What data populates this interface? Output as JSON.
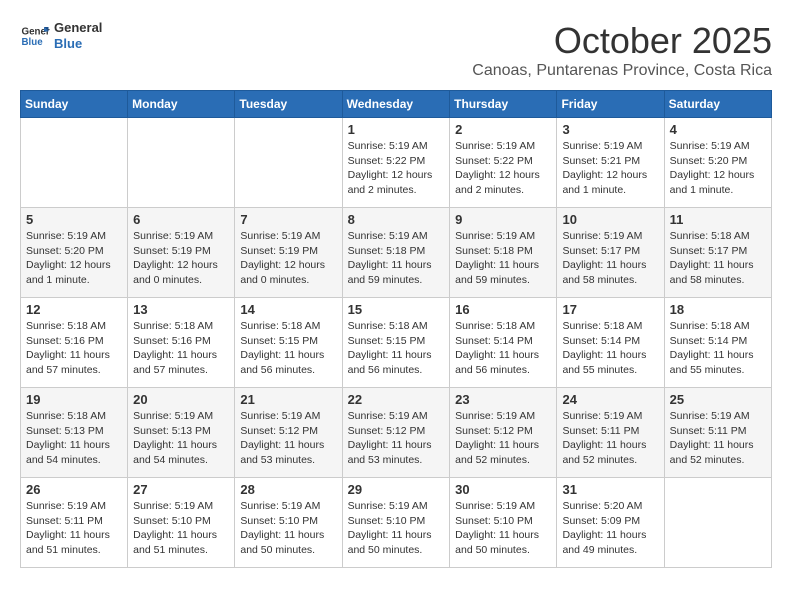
{
  "logo": {
    "line1": "General",
    "line2": "Blue"
  },
  "title": "October 2025",
  "location": "Canoas, Puntarenas Province, Costa Rica",
  "days_of_week": [
    "Sunday",
    "Monday",
    "Tuesday",
    "Wednesday",
    "Thursday",
    "Friday",
    "Saturday"
  ],
  "weeks": [
    [
      {
        "day": "",
        "info": ""
      },
      {
        "day": "",
        "info": ""
      },
      {
        "day": "",
        "info": ""
      },
      {
        "day": "1",
        "info": "Sunrise: 5:19 AM\nSunset: 5:22 PM\nDaylight: 12 hours and 2 minutes."
      },
      {
        "day": "2",
        "info": "Sunrise: 5:19 AM\nSunset: 5:22 PM\nDaylight: 12 hours and 2 minutes."
      },
      {
        "day": "3",
        "info": "Sunrise: 5:19 AM\nSunset: 5:21 PM\nDaylight: 12 hours and 1 minute."
      },
      {
        "day": "4",
        "info": "Sunrise: 5:19 AM\nSunset: 5:20 PM\nDaylight: 12 hours and 1 minute."
      }
    ],
    [
      {
        "day": "5",
        "info": "Sunrise: 5:19 AM\nSunset: 5:20 PM\nDaylight: 12 hours and 1 minute."
      },
      {
        "day": "6",
        "info": "Sunrise: 5:19 AM\nSunset: 5:19 PM\nDaylight: 12 hours and 0 minutes."
      },
      {
        "day": "7",
        "info": "Sunrise: 5:19 AM\nSunset: 5:19 PM\nDaylight: 12 hours and 0 minutes."
      },
      {
        "day": "8",
        "info": "Sunrise: 5:19 AM\nSunset: 5:18 PM\nDaylight: 11 hours and 59 minutes."
      },
      {
        "day": "9",
        "info": "Sunrise: 5:19 AM\nSunset: 5:18 PM\nDaylight: 11 hours and 59 minutes."
      },
      {
        "day": "10",
        "info": "Sunrise: 5:19 AM\nSunset: 5:17 PM\nDaylight: 11 hours and 58 minutes."
      },
      {
        "day": "11",
        "info": "Sunrise: 5:18 AM\nSunset: 5:17 PM\nDaylight: 11 hours and 58 minutes."
      }
    ],
    [
      {
        "day": "12",
        "info": "Sunrise: 5:18 AM\nSunset: 5:16 PM\nDaylight: 11 hours and 57 minutes."
      },
      {
        "day": "13",
        "info": "Sunrise: 5:18 AM\nSunset: 5:16 PM\nDaylight: 11 hours and 57 minutes."
      },
      {
        "day": "14",
        "info": "Sunrise: 5:18 AM\nSunset: 5:15 PM\nDaylight: 11 hours and 56 minutes."
      },
      {
        "day": "15",
        "info": "Sunrise: 5:18 AM\nSunset: 5:15 PM\nDaylight: 11 hours and 56 minutes."
      },
      {
        "day": "16",
        "info": "Sunrise: 5:18 AM\nSunset: 5:14 PM\nDaylight: 11 hours and 56 minutes."
      },
      {
        "day": "17",
        "info": "Sunrise: 5:18 AM\nSunset: 5:14 PM\nDaylight: 11 hours and 55 minutes."
      },
      {
        "day": "18",
        "info": "Sunrise: 5:18 AM\nSunset: 5:14 PM\nDaylight: 11 hours and 55 minutes."
      }
    ],
    [
      {
        "day": "19",
        "info": "Sunrise: 5:18 AM\nSunset: 5:13 PM\nDaylight: 11 hours and 54 minutes."
      },
      {
        "day": "20",
        "info": "Sunrise: 5:19 AM\nSunset: 5:13 PM\nDaylight: 11 hours and 54 minutes."
      },
      {
        "day": "21",
        "info": "Sunrise: 5:19 AM\nSunset: 5:12 PM\nDaylight: 11 hours and 53 minutes."
      },
      {
        "day": "22",
        "info": "Sunrise: 5:19 AM\nSunset: 5:12 PM\nDaylight: 11 hours and 53 minutes."
      },
      {
        "day": "23",
        "info": "Sunrise: 5:19 AM\nSunset: 5:12 PM\nDaylight: 11 hours and 52 minutes."
      },
      {
        "day": "24",
        "info": "Sunrise: 5:19 AM\nSunset: 5:11 PM\nDaylight: 11 hours and 52 minutes."
      },
      {
        "day": "25",
        "info": "Sunrise: 5:19 AM\nSunset: 5:11 PM\nDaylight: 11 hours and 52 minutes."
      }
    ],
    [
      {
        "day": "26",
        "info": "Sunrise: 5:19 AM\nSunset: 5:11 PM\nDaylight: 11 hours and 51 minutes."
      },
      {
        "day": "27",
        "info": "Sunrise: 5:19 AM\nSunset: 5:10 PM\nDaylight: 11 hours and 51 minutes."
      },
      {
        "day": "28",
        "info": "Sunrise: 5:19 AM\nSunset: 5:10 PM\nDaylight: 11 hours and 50 minutes."
      },
      {
        "day": "29",
        "info": "Sunrise: 5:19 AM\nSunset: 5:10 PM\nDaylight: 11 hours and 50 minutes."
      },
      {
        "day": "30",
        "info": "Sunrise: 5:19 AM\nSunset: 5:10 PM\nDaylight: 11 hours and 50 minutes."
      },
      {
        "day": "31",
        "info": "Sunrise: 5:20 AM\nSunset: 5:09 PM\nDaylight: 11 hours and 49 minutes."
      },
      {
        "day": "",
        "info": ""
      }
    ]
  ]
}
